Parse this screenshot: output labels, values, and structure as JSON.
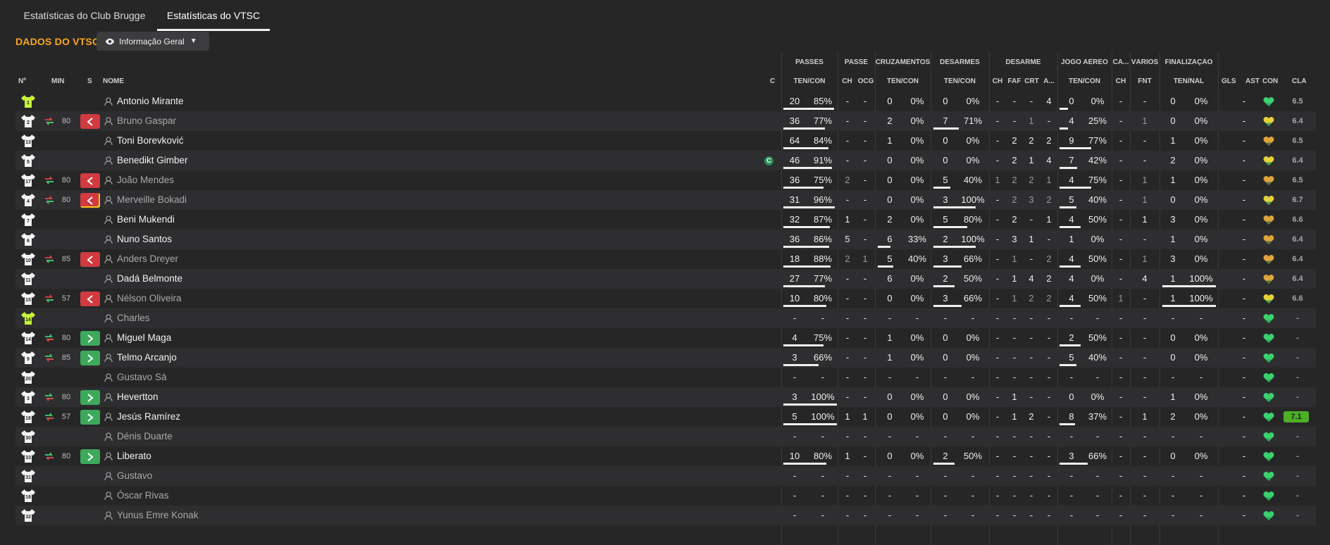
{
  "tabs": [
    "Estatísticas do Club Brugge",
    "Estatísticas do VTSC"
  ],
  "title": "DADOS DO VTSC",
  "view_button": "Informação Geral",
  "header": {
    "groups": [
      "PASSES",
      "PASSE",
      "CRUZAMENTOS",
      "DESARMES",
      "DESARME",
      "JOGO AÉREO",
      "CA...",
      "VÁRIOS",
      "FINALIZAÇÃO"
    ],
    "cols": {
      "n": "Nº",
      "min": "MIN",
      "s": "S",
      "name": "NOME",
      "c": "C",
      "gls": "GLS",
      "ast": "AST",
      "con": "CON",
      "cla": "CLA"
    },
    "subs": [
      "TEN/CON",
      "CH",
      "OCG",
      "TEN/CON",
      "TEN/CON",
      "CH",
      "FAF",
      "CRT",
      "A...",
      "TEN/CON",
      "CH",
      "FNT",
      "TEN/NAL"
    ]
  },
  "colors": {
    "accent": "#f6a623",
    "sub_off": "#d13a3f",
    "sub_on": "#3daa5b",
    "gk_kit": "#c6f23a",
    "best_rating": "#4caf27"
  },
  "players": [
    {
      "num": "1",
      "gk": true,
      "min": "",
      "sub": "",
      "name": "Antonio Mirante",
      "dim": false,
      "captain": false,
      "v": [
        "20",
        "85%",
        "-",
        "-",
        "0",
        "0%",
        "0",
        "0%",
        "-",
        "-",
        "-",
        "4",
        "0",
        "0%",
        "-",
        "-",
        "0",
        "0%",
        "-"
      ],
      "b": [
        0.95,
        0,
        0,
        0.2
      ],
      "con": "green",
      "cla": "6.5"
    },
    {
      "num": "2",
      "gk": false,
      "min": "80",
      "sub": "off",
      "name": "Bruno Gaspar",
      "dim": true,
      "captain": false,
      "v": [
        "36",
        "77%",
        "-",
        "-",
        "2",
        "0%",
        "7",
        "71%",
        "-",
        "-",
        "1",
        "-",
        "4",
        "25%",
        "-",
        "1",
        "0",
        "0%",
        "-"
      ],
      "b": [
        0.77,
        0,
        0.6,
        0.2
      ],
      "con": "yellow",
      "cla": "6.4"
    },
    {
      "num": "13",
      "gk": false,
      "min": "",
      "sub": "",
      "name": "Toni Borevković",
      "dim": false,
      "captain": false,
      "v": [
        "64",
        "84%",
        "-",
        "-",
        "1",
        "0%",
        "0",
        "0%",
        "-",
        "2",
        "2",
        "2",
        "9",
        "77%",
        "-",
        "-",
        "1",
        "0%",
        "-"
      ],
      "b": [
        0.84,
        0,
        0,
        0.75
      ],
      "con": "orange",
      "cla": "6.5"
    },
    {
      "num": "5",
      "gk": false,
      "min": "",
      "sub": "",
      "name": "Benedikt Gimber",
      "dim": false,
      "captain": true,
      "v": [
        "46",
        "91%",
        "-",
        "-",
        "0",
        "0%",
        "0",
        "0%",
        "-",
        "2",
        "1",
        "4",
        "7",
        "42%",
        "-",
        "-",
        "2",
        "0%",
        "-"
      ],
      "b": [
        0.91,
        0,
        0,
        0.42
      ],
      "con": "yellow",
      "cla": "6.4"
    },
    {
      "num": "17",
      "gk": false,
      "min": "80",
      "sub": "off",
      "name": "João Mendes",
      "dim": true,
      "captain": false,
      "v": [
        "36",
        "75%",
        "2",
        "-",
        "0",
        "0%",
        "5",
        "40%",
        "1",
        "2",
        "2",
        "1",
        "4",
        "75%",
        "-",
        "1",
        "1",
        "0%",
        "-"
      ],
      "b": [
        0.75,
        0,
        0.4,
        0.75
      ],
      "con": "orange",
      "cla": "6.5"
    },
    {
      "num": "4",
      "gk": false,
      "min": "80",
      "sub": "off",
      "warn": true,
      "name": "Merveille Bokadi",
      "dim": true,
      "captain": false,
      "v": [
        "31",
        "96%",
        "-",
        "-",
        "0",
        "0%",
        "3",
        "100%",
        "-",
        "2",
        "3",
        "2",
        "5",
        "40%",
        "-",
        "1",
        "0",
        "0%",
        "-"
      ],
      "b": [
        0.96,
        0,
        1,
        0.4
      ],
      "con": "yellow",
      "cla": "6.7"
    },
    {
      "num": "7",
      "gk": false,
      "min": "",
      "sub": "",
      "name": "Beni Mukendi",
      "dim": false,
      "captain": false,
      "v": [
        "32",
        "87%",
        "1",
        "-",
        "2",
        "0%",
        "5",
        "80%",
        "-",
        "2",
        "-",
        "1",
        "4",
        "50%",
        "-",
        "1",
        "3",
        "0%",
        "-"
      ],
      "b": [
        0.87,
        0,
        0.8,
        0.5
      ],
      "con": "orange",
      "cla": "6.6"
    },
    {
      "num": "6",
      "gk": false,
      "min": "",
      "sub": "",
      "name": "Nuno Santos",
      "dim": false,
      "captain": false,
      "v": [
        "36",
        "86%",
        "5",
        "-",
        "6",
        "33%",
        "2",
        "100%",
        "-",
        "3",
        "1",
        "-",
        "1",
        "0%",
        "-",
        "-",
        "1",
        "0%",
        "-"
      ],
      "b": [
        0.86,
        0.33,
        1,
        0
      ],
      "con": "orange",
      "cla": "6.4"
    },
    {
      "num": "10",
      "gk": false,
      "min": "85",
      "sub": "off",
      "name": "Anders Dreyer",
      "dim": true,
      "captain": false,
      "v": [
        "18",
        "88%",
        "2",
        "1",
        "5",
        "40%",
        "3",
        "66%",
        "-",
        "1",
        "-",
        "2",
        "4",
        "50%",
        "-",
        "1",
        "3",
        "0%",
        "-"
      ],
      "b": [
        0.88,
        0.4,
        0.66,
        0.5
      ],
      "con": "orange",
      "cla": "6.4"
    },
    {
      "num": "11",
      "gk": false,
      "min": "",
      "sub": "",
      "name": "Dadá Belmonte",
      "dim": false,
      "captain": false,
      "v": [
        "27",
        "77%",
        "-",
        "-",
        "6",
        "0%",
        "2",
        "50%",
        "-",
        "1",
        "4",
        "2",
        "4",
        "0%",
        "-",
        "4",
        "1",
        "100%",
        "-"
      ],
      "b": [
        0.77,
        0,
        0.5,
        0,
        1
      ],
      "con": "orange",
      "cla": "6.4"
    },
    {
      "num": "15",
      "gk": false,
      "min": "57",
      "sub": "off",
      "name": "Nélson Oliveira",
      "dim": true,
      "captain": false,
      "v": [
        "10",
        "80%",
        "-",
        "-",
        "0",
        "0%",
        "3",
        "66%",
        "-",
        "1",
        "2",
        "2",
        "4",
        "50%",
        "1",
        "-",
        "1",
        "100%",
        "-"
      ],
      "b": [
        0.8,
        0,
        0.66,
        0.5,
        1
      ],
      "con": "yellow",
      "cla": "6.6"
    },
    {
      "num": "14",
      "gk": true,
      "min": "",
      "sub": "",
      "name": "Charles",
      "dim": true,
      "captain": false,
      "v": [
        "-",
        "-",
        "-",
        "-",
        "-",
        "-",
        "-",
        "-",
        "-",
        "-",
        "-",
        "-",
        "-",
        "-",
        "-",
        "-",
        "-",
        "-",
        "-"
      ],
      "b": [],
      "con": "green",
      "cla": "-"
    },
    {
      "num": "14",
      "gk": false,
      "min": "80",
      "sub": "on",
      "name": "Miguel Maga",
      "dim": false,
      "captain": false,
      "v": [
        "4",
        "75%",
        "-",
        "-",
        "1",
        "0%",
        "0",
        "0%",
        "-",
        "-",
        "-",
        "-",
        "2",
        "50%",
        "-",
        "-",
        "0",
        "0%",
        "-"
      ],
      "b": [
        0.75,
        0,
        0,
        0.5
      ],
      "con": "green",
      "cla": "-"
    },
    {
      "num": "9",
      "gk": false,
      "min": "85",
      "sub": "on",
      "name": "Telmo Arcanjo",
      "dim": false,
      "captain": false,
      "v": [
        "3",
        "66%",
        "-",
        "-",
        "1",
        "0%",
        "0",
        "0%",
        "-",
        "-",
        "-",
        "-",
        "5",
        "40%",
        "-",
        "-",
        "0",
        "0%",
        "-"
      ],
      "b": [
        0.66,
        0,
        0,
        0.4
      ],
      "con": "green",
      "cla": "-"
    },
    {
      "num": "20",
      "gk": false,
      "min": "",
      "sub": "",
      "name": "Gustavo Sá",
      "dim": true,
      "captain": false,
      "v": [
        "-",
        "-",
        "-",
        "-",
        "-",
        "-",
        "-",
        "-",
        "-",
        "-",
        "-",
        "-",
        "-",
        "-",
        "-",
        "-",
        "-",
        "-",
        "-"
      ],
      "b": [],
      "con": "green",
      "cla": "-"
    },
    {
      "num": "3",
      "gk": false,
      "min": "80",
      "sub": "on",
      "name": "Hevertton",
      "dim": false,
      "captain": false,
      "v": [
        "3",
        "100%",
        "-",
        "-",
        "0",
        "0%",
        "0",
        "0%",
        "-",
        "1",
        "-",
        "-",
        "0",
        "0%",
        "-",
        "-",
        "1",
        "0%",
        "-"
      ],
      "b": [
        1,
        0,
        0,
        0
      ],
      "con": "green",
      "cla": "-"
    },
    {
      "num": "16",
      "gk": false,
      "min": "57",
      "sub": "on",
      "name": "Jesús Ramírez",
      "dim": false,
      "captain": false,
      "v": [
        "5",
        "100%",
        "1",
        "1",
        "0",
        "0%",
        "0",
        "0%",
        "-",
        "1",
        "2",
        "-",
        "8",
        "37%",
        "-",
        "1",
        "2",
        "0%",
        "-"
      ],
      "b": [
        1,
        0,
        0,
        0.37
      ],
      "con": "green",
      "cla": "7.1",
      "best": true
    },
    {
      "num": "30",
      "gk": false,
      "min": "",
      "sub": "",
      "name": "Dénis Duarte",
      "dim": true,
      "captain": false,
      "v": [
        "-",
        "-",
        "-",
        "-",
        "-",
        "-",
        "-",
        "-",
        "-",
        "-",
        "-",
        "-",
        "-",
        "-",
        "-",
        "-",
        "-",
        "-",
        "-"
      ],
      "b": [],
      "con": "green",
      "cla": "-"
    },
    {
      "num": "33",
      "gk": false,
      "min": "80",
      "sub": "on",
      "name": "Liberato",
      "dim": false,
      "captain": false,
      "v": [
        "10",
        "80%",
        "1",
        "-",
        "0",
        "0%",
        "2",
        "50%",
        "-",
        "-",
        "-",
        "-",
        "3",
        "66%",
        "-",
        "-",
        "0",
        "0%",
        "-"
      ],
      "b": [
        0.8,
        0,
        0.5,
        0.66
      ],
      "con": "green",
      "cla": "-"
    },
    {
      "num": "31",
      "gk": false,
      "min": "",
      "sub": "",
      "name": "Gustavo",
      "dim": true,
      "captain": false,
      "v": [
        "-",
        "-",
        "-",
        "-",
        "-",
        "-",
        "-",
        "-",
        "-",
        "-",
        "-",
        "-",
        "-",
        "-",
        "-",
        "-",
        "-",
        "-",
        "-"
      ],
      "b": [],
      "con": "green",
      "cla": "-"
    },
    {
      "num": "18",
      "gk": false,
      "min": "",
      "sub": "",
      "name": "Óscar Rivas",
      "dim": true,
      "captain": false,
      "v": [
        "-",
        "-",
        "-",
        "-",
        "-",
        "-",
        "-",
        "-",
        "-",
        "-",
        "-",
        "-",
        "-",
        "-",
        "-",
        "-",
        "-",
        "-",
        "-"
      ],
      "b": [],
      "con": "green",
      "cla": "-"
    },
    {
      "num": "32",
      "gk": false,
      "min": "",
      "sub": "",
      "name": "Yunus Emre Konak",
      "dim": true,
      "captain": false,
      "v": [
        "-",
        "-",
        "-",
        "-",
        "-",
        "-",
        "-",
        "-",
        "-",
        "-",
        "-",
        "-",
        "-",
        "-",
        "-",
        "-",
        "-",
        "-",
        "-"
      ],
      "b": [],
      "con": "green",
      "cla": "-"
    }
  ]
}
